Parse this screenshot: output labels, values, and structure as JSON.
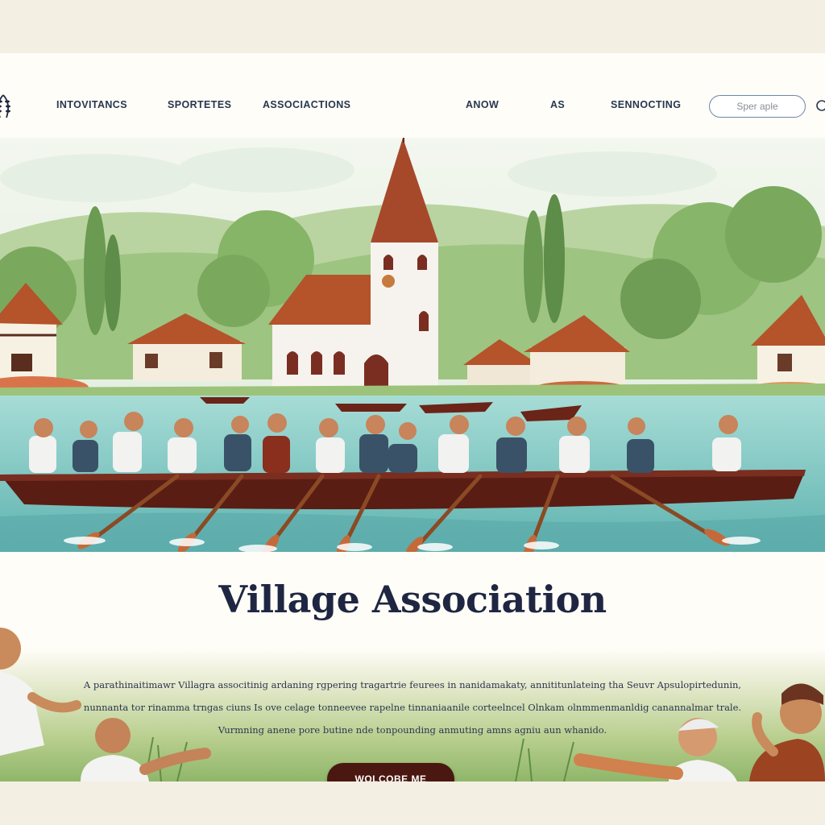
{
  "nav": {
    "links": [
      {
        "label": "INTOVITANCS"
      },
      {
        "label": "SPORTETES"
      },
      {
        "label": "ASSOCIACTIONS"
      },
      {
        "label": "ANOW"
      },
      {
        "label": "AS"
      },
      {
        "label": "SENNOCTING"
      }
    ],
    "search": {
      "placeholder": "Sper aple"
    }
  },
  "main": {
    "title": "Village Association",
    "paragraph": [
      "A parathinaitimawr Villagra associtinig ardaning rgpering tragartrie feurees in nanidamakaty, annititunlateing tha Seuvr Apsulopirtedunin,",
      "nunnanta tor rinamma trngas ciuns Is ove celage tonneevee rapelne tinnaniaanile corteelncel Olnkam olnmmenmanldig canannalmar trale.",
      "Vurmning anene pore butine nde tonpounding anmuting amns agniu aun whanido."
    ],
    "cta": "WOLCOBE ME"
  },
  "colors": {
    "page_bg": "#fffdf8",
    "outer_bg": "#f4efe3",
    "title": "#1e2642",
    "nav_text": "#26384f",
    "cta_bg": "#4a1711",
    "water": "#8ecfcf",
    "boat": "#5a1d14",
    "roof": "#b5532b"
  },
  "icons": {
    "logo": "laurel-wreath-icon",
    "search": "search-icon"
  }
}
